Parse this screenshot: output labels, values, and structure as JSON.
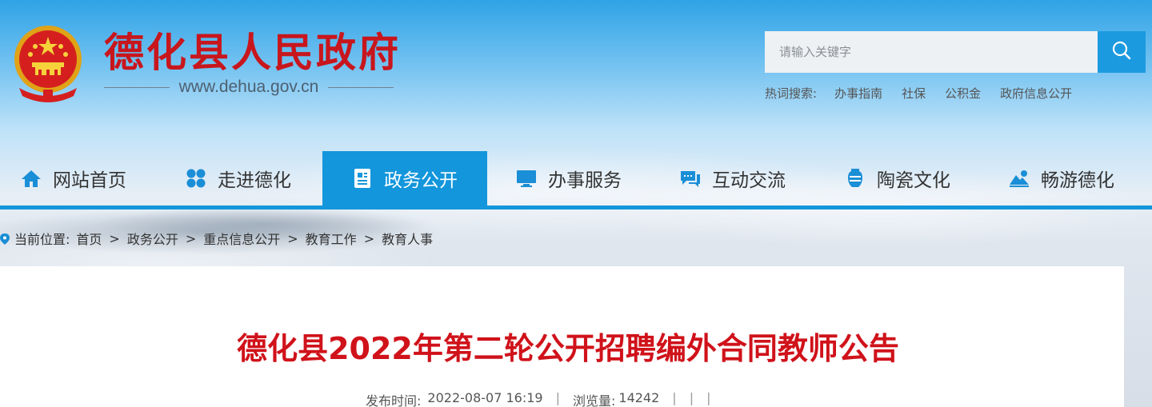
{
  "header": {
    "site_title": "德化县人民政府",
    "site_url": "www.dehua.gov.cn",
    "emblem_icon": "national-emblem-icon"
  },
  "search": {
    "placeholder": "请输入关键字",
    "button_icon": "search-icon"
  },
  "hotwords": {
    "label": "热词搜索:",
    "items": [
      "办事指南",
      "社保",
      "公积金",
      "政府信息公开"
    ]
  },
  "nav": {
    "items": [
      {
        "label": "网站首页",
        "icon": "home-icon"
      },
      {
        "label": "走进德化",
        "icon": "grid-icon"
      },
      {
        "label": "政务公开",
        "icon": "document-icon",
        "active": true
      },
      {
        "label": "办事服务",
        "icon": "monitor-icon"
      },
      {
        "label": "互动交流",
        "icon": "chat-icon"
      },
      {
        "label": "陶瓷文化",
        "icon": "vase-icon"
      },
      {
        "label": "畅游德化",
        "icon": "landscape-icon"
      }
    ],
    "active_color": "#1396db"
  },
  "breadcrumb": {
    "label": "当前位置:",
    "items": [
      "首页",
      "政务公开",
      "重点信息公开",
      "教育工作",
      "教育人事"
    ],
    "separator": ">"
  },
  "article": {
    "title": "德化县2022年第二轮公开招聘编外合同教师公告",
    "publish_label": "发布时间:",
    "publish_time": "2022-08-07 16:19",
    "views_label": "浏览量:",
    "views": "14242"
  },
  "colors": {
    "brand_red": "#c8161d",
    "accent_blue": "#1396db"
  }
}
